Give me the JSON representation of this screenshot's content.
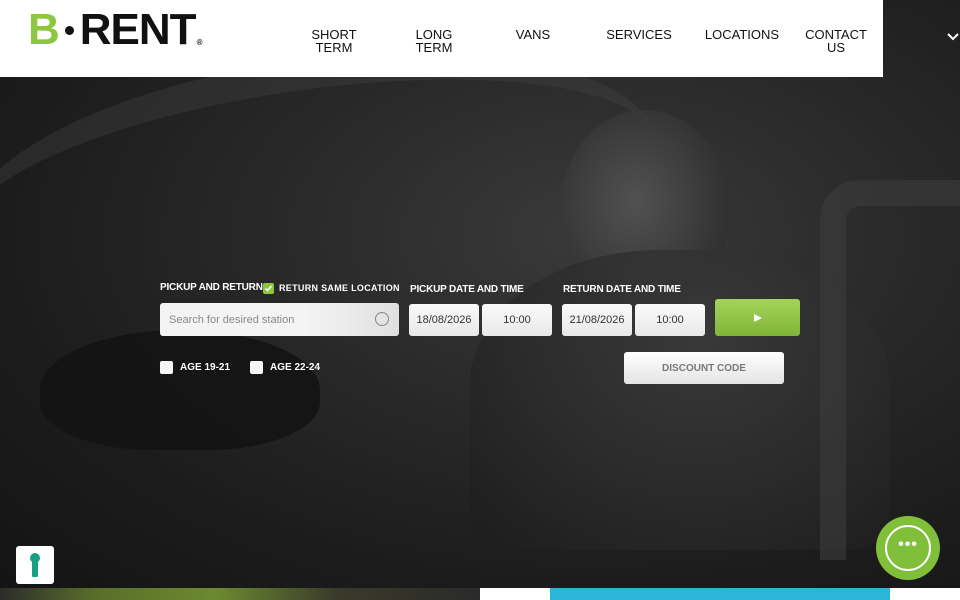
{
  "brand": {
    "logo_b": "B",
    "logo_rest": "RENT",
    "logo_reg": "®",
    "accent": "#8dc63f"
  },
  "nav": {
    "items": [
      {
        "label": "SHORT\nTERM"
      },
      {
        "label": "LONG\nTERM"
      },
      {
        "label": "VANS"
      },
      {
        "label": "SERVICES"
      },
      {
        "label": "LOCATIONS"
      },
      {
        "label": "CONTACT\nUS"
      }
    ],
    "menu_icon": "chevron-down-icon"
  },
  "booking": {
    "pickup_label": "PICKUP AND RETURN",
    "same_location_label": "RETURN SAME LOCATION",
    "same_location_checked": true,
    "search_placeholder": "Search for desired station",
    "pickup_datetime_label": "PICKUP DATE AND TIME",
    "pickup_date": "18/08/2026",
    "pickup_time": "10:00",
    "return_datetime_label": "RETURN DATE AND TIME",
    "return_date": "21/08/2026",
    "return_time": "10:00",
    "submit_icon": "play-arrow-icon",
    "age_options": [
      {
        "label": "AGE 19-21",
        "checked": false
      },
      {
        "label": "AGE 22-24",
        "checked": false
      }
    ],
    "discount_label": "DISCOUNT CODE"
  },
  "widgets": {
    "accessibility_icon": "keyhole-icon",
    "chat_icon": "chat-bubble-icon",
    "chat_color": "#7fbf3a"
  }
}
